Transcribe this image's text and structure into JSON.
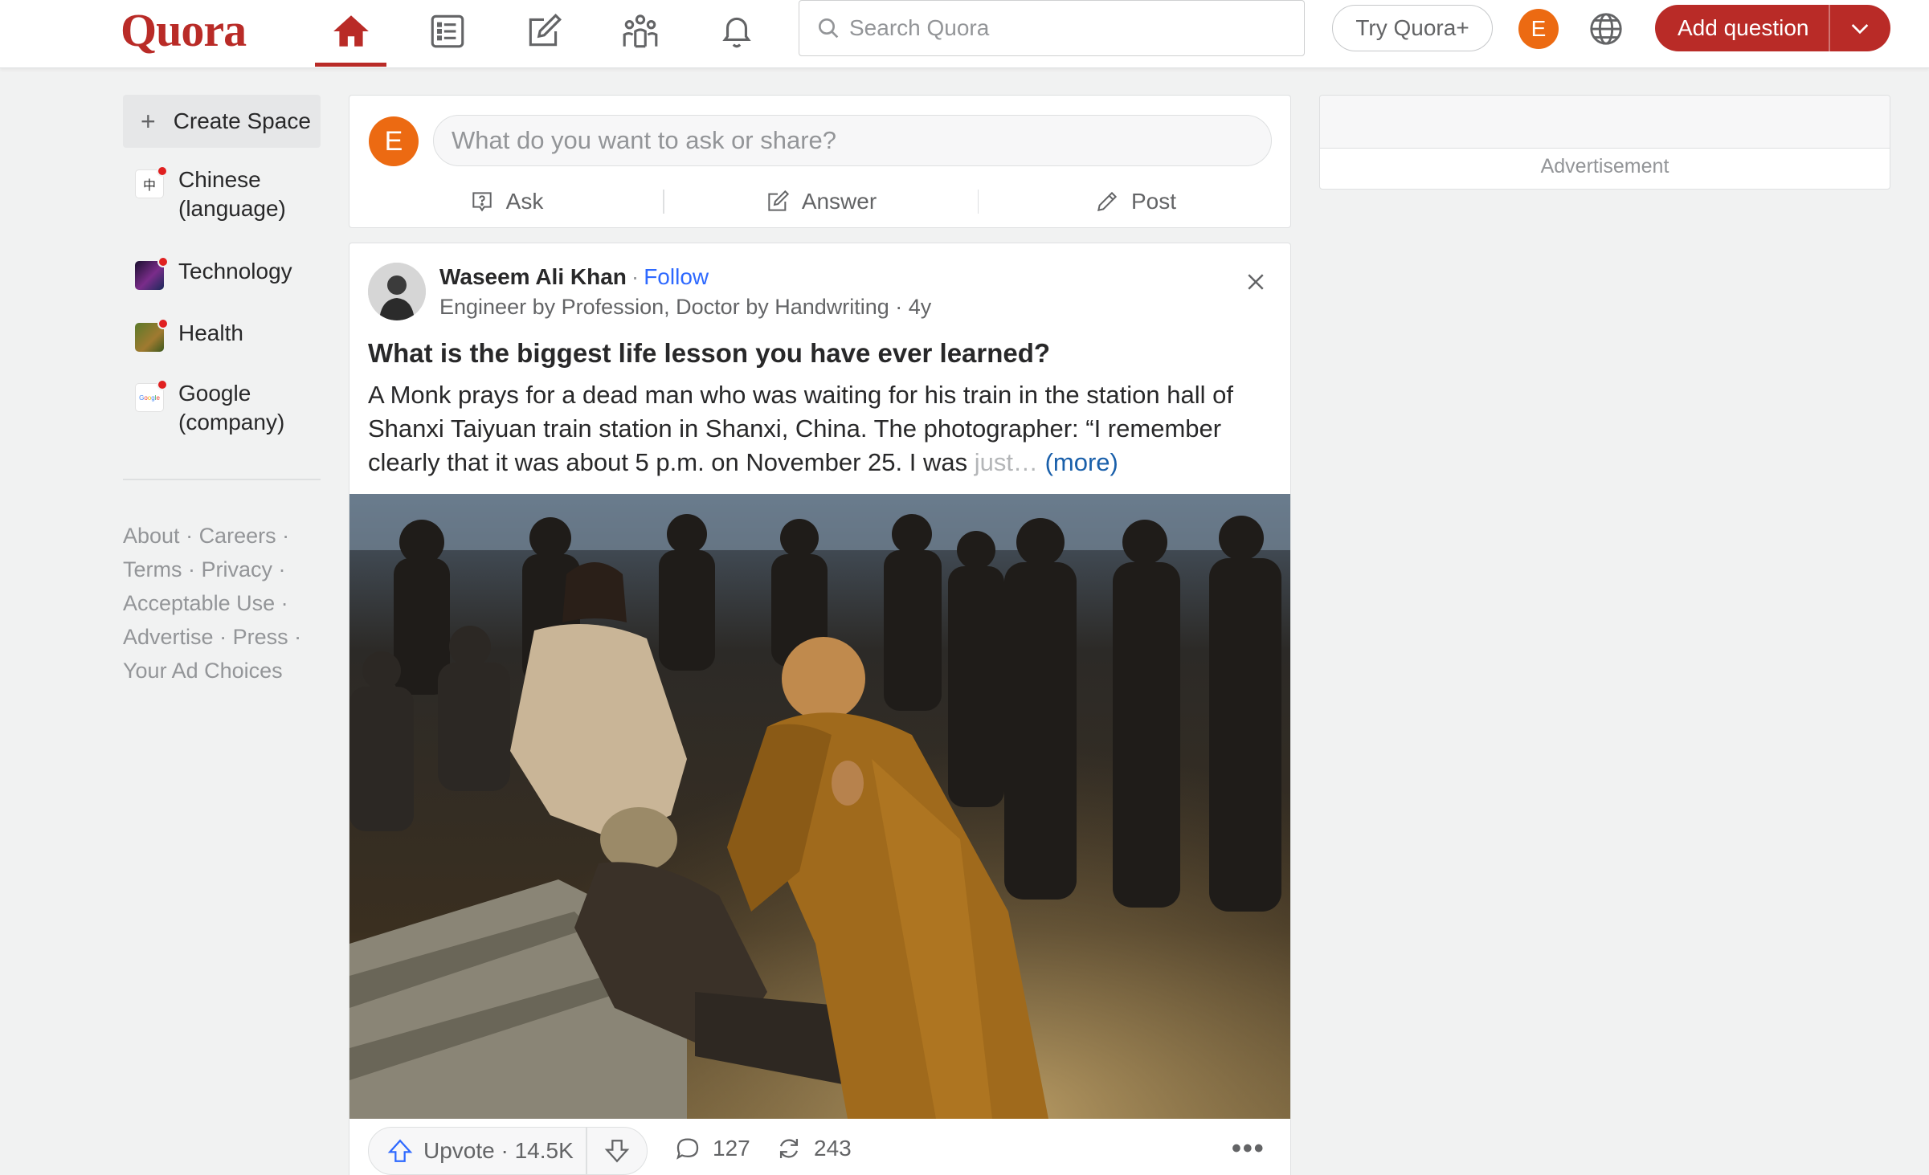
{
  "header": {
    "logo": "Quora",
    "search_placeholder": "Search Quora",
    "try_plus": "Try Quora+",
    "user_initial": "E",
    "add_question": "Add question"
  },
  "sidebar": {
    "create_space": "Create Space",
    "spaces": [
      {
        "label": "Chinese (language)",
        "line1": "Chinese",
        "line2": "(language)"
      },
      {
        "label": "Technology"
      },
      {
        "label": "Health"
      },
      {
        "label": "Google (company)",
        "line1": "Google",
        "line2": "(company)"
      }
    ],
    "footer": [
      "About",
      "Careers",
      "Terms",
      "Privacy",
      "Acceptable Use",
      "Advertise",
      "Press",
      "Your Ad Choices"
    ]
  },
  "ask_box": {
    "avatar_initial": "E",
    "placeholder": "What do you want to ask or share?",
    "actions": [
      "Ask",
      "Answer",
      "Post"
    ]
  },
  "post": {
    "author": "Waseem Ali Khan",
    "follow": "Follow",
    "credential": "Engineer by Profession, Doctor by Handwriting · 4y",
    "question": "What is the biggest life lesson you have ever learned?",
    "excerpt": "A Monk prays for a dead man who was waiting for his train in the station hall of Shanxi Taiyuan train station in Shanxi, China. The photographer: “I remember clearly that it was about 5 p.m. on November 25. I was ",
    "excerpt_fade": "just…",
    "more": "(more)",
    "upvote": "Upvote · 14.5K",
    "comments": "127",
    "shares": "243"
  },
  "ad": {
    "label": "Advertisement"
  },
  "colors": {
    "brand": "#b92b27",
    "link": "#2e69ff",
    "avatar": "#ec6a12"
  }
}
